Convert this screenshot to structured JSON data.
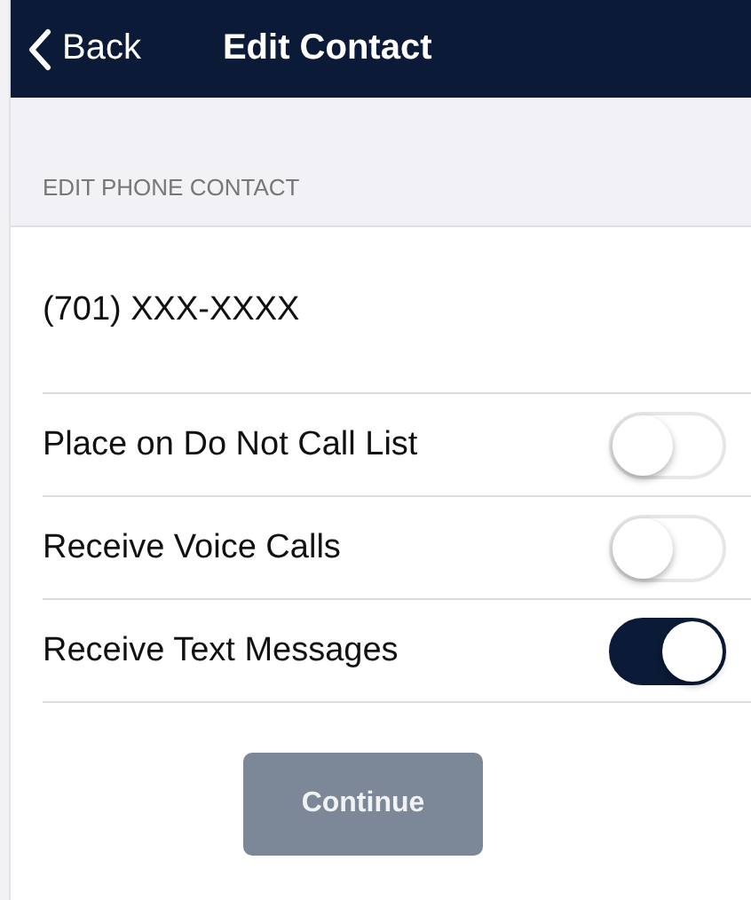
{
  "nav_bar": {
    "back_label": "Back",
    "title": "Edit Contact"
  },
  "section": {
    "header": "EDIT PHONE CONTACT",
    "phone": "(701) XXX-XXXX"
  },
  "toggles": [
    {
      "label": "Place on Do Not Call List",
      "on": false
    },
    {
      "label": "Receive Voice Calls",
      "on": false
    },
    {
      "label": "Receive Text Messages",
      "on": true
    }
  ],
  "continue_button": {
    "label": "Continue",
    "disabled": true
  }
}
